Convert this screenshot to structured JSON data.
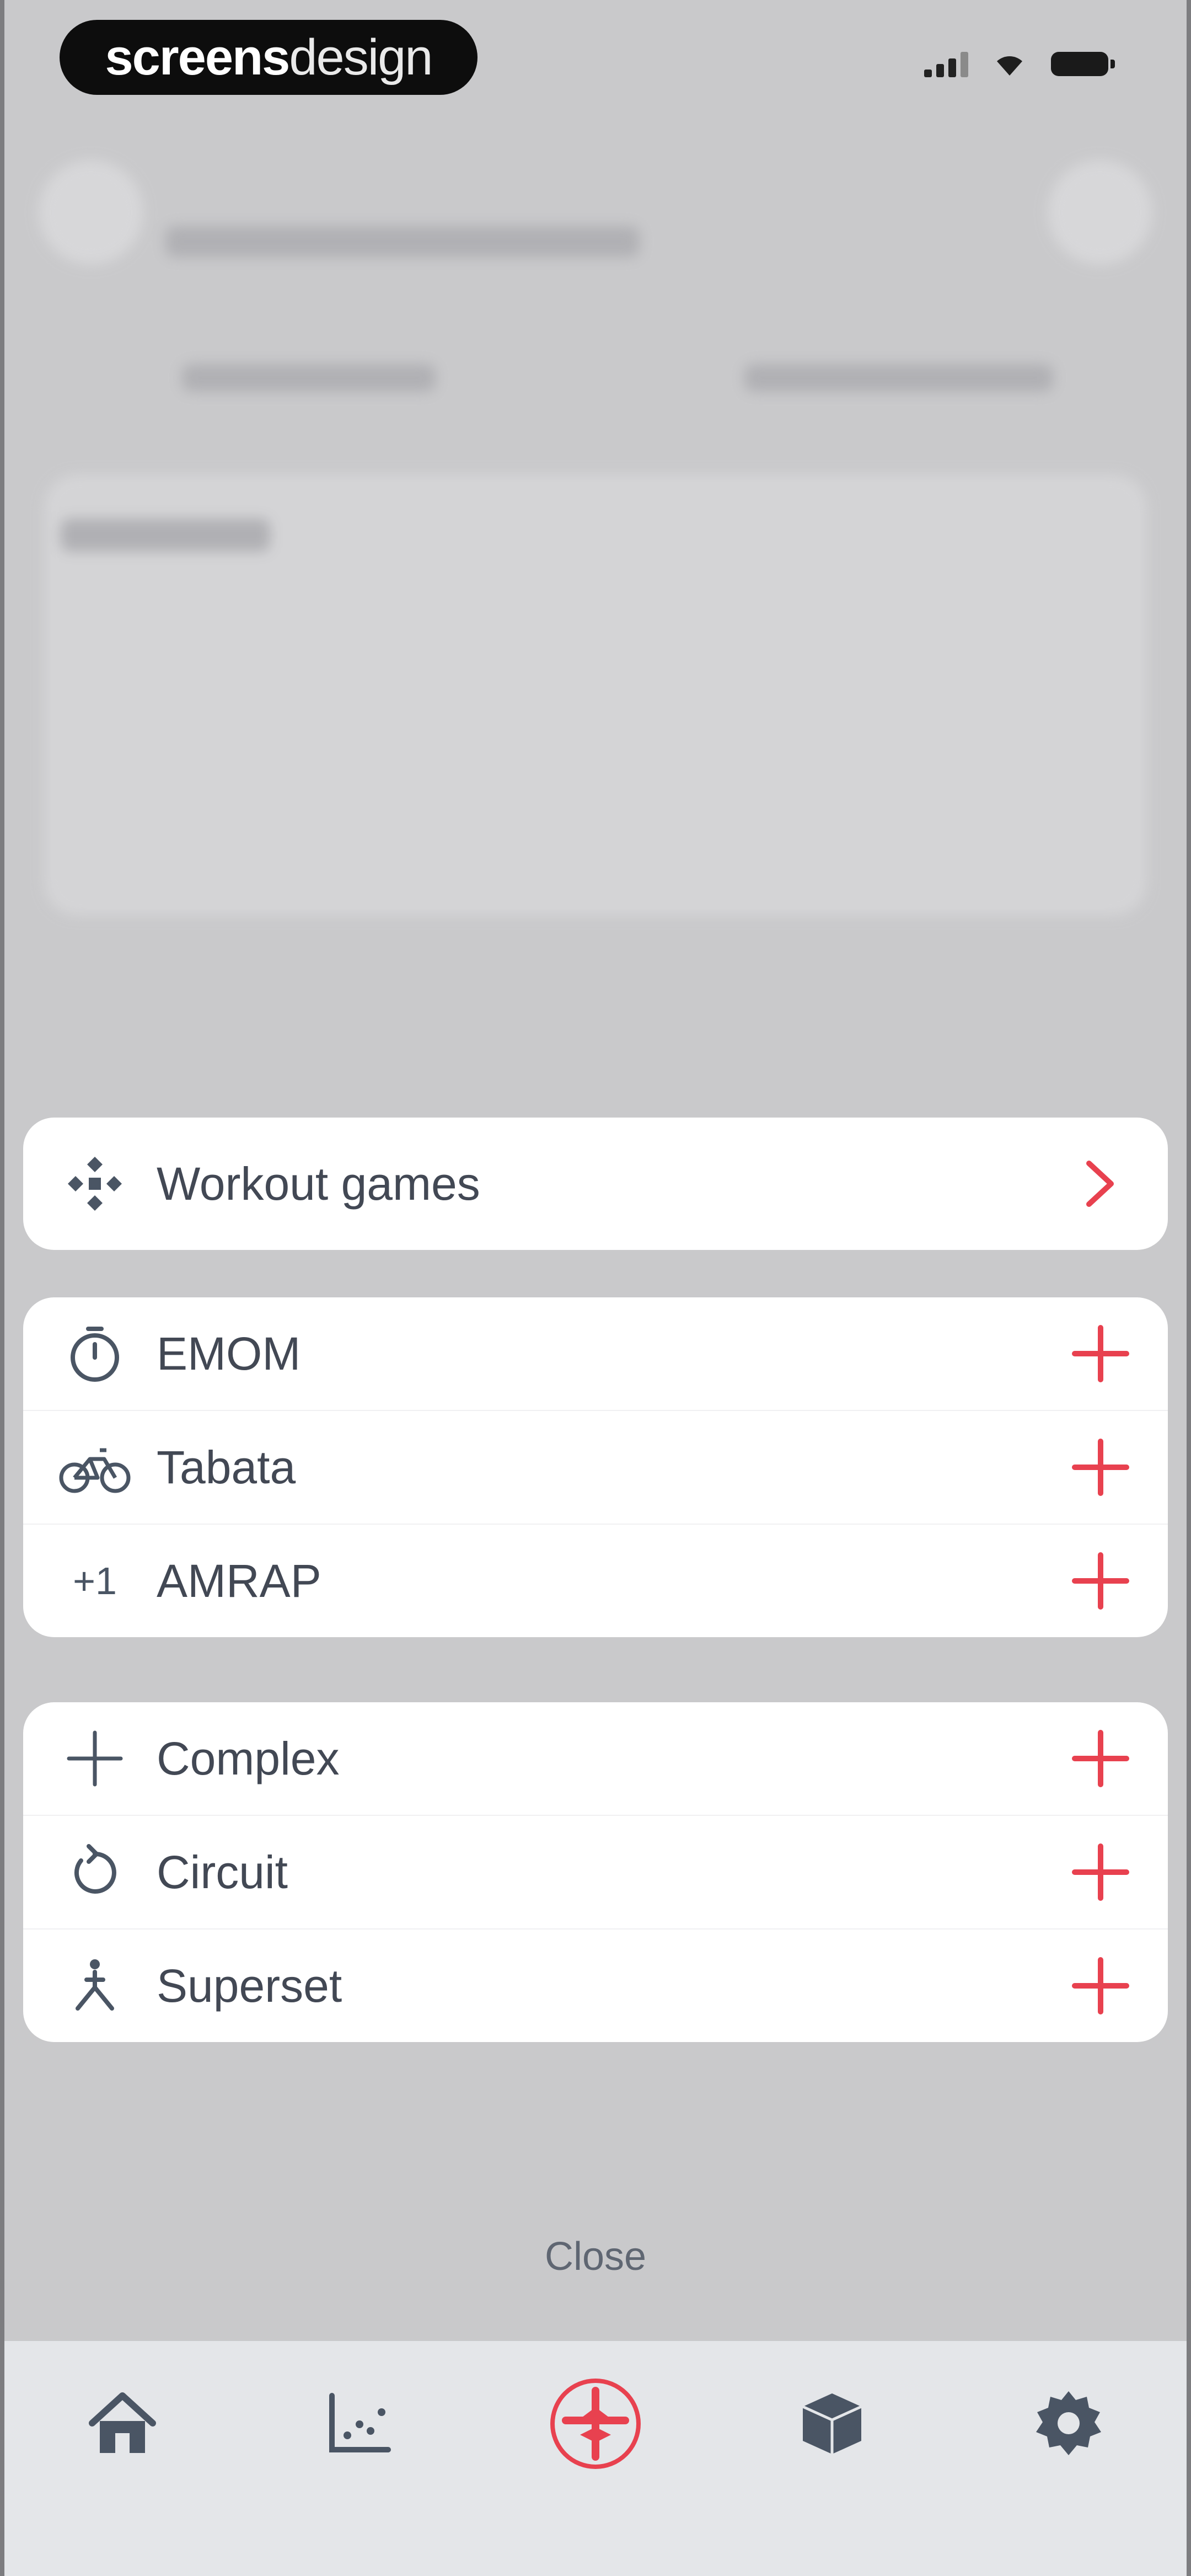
{
  "status_bar": {
    "brand_bold": "screens",
    "brand_light": "design"
  },
  "menu": {
    "games": {
      "label": "Workout games",
      "icon": "gamepad-icon",
      "action_icon": "chevron-right-icon"
    },
    "timed": [
      {
        "label": "EMOM",
        "icon": "stopwatch-icon"
      },
      {
        "label": "Tabata",
        "icon": "bicycle-icon"
      },
      {
        "label": "AMRAP",
        "icon": "plus-one-icon",
        "icon_text": "+1"
      }
    ],
    "structures": [
      {
        "label": "Complex",
        "icon": "plus-icon"
      },
      {
        "label": "Circuit",
        "icon": "rotate-icon"
      },
      {
        "label": "Superset",
        "icon": "superset-icon"
      }
    ],
    "add_icon": "plus-icon",
    "close_label": "Close"
  },
  "tabbar": {
    "items": [
      {
        "name": "home",
        "icon": "home-icon"
      },
      {
        "name": "stats",
        "icon": "chart-icon"
      },
      {
        "name": "workout",
        "icon": "add-workout-icon",
        "active": true
      },
      {
        "name": "library",
        "icon": "box-icon"
      },
      {
        "name": "settings",
        "icon": "gear-icon"
      }
    ]
  },
  "colors": {
    "accent": "#e8414f",
    "icon": "#4a5564",
    "text": "#424854",
    "background": "#c9c9cb",
    "panel": "#ffffff",
    "tabbar": "#e4e6e9"
  }
}
